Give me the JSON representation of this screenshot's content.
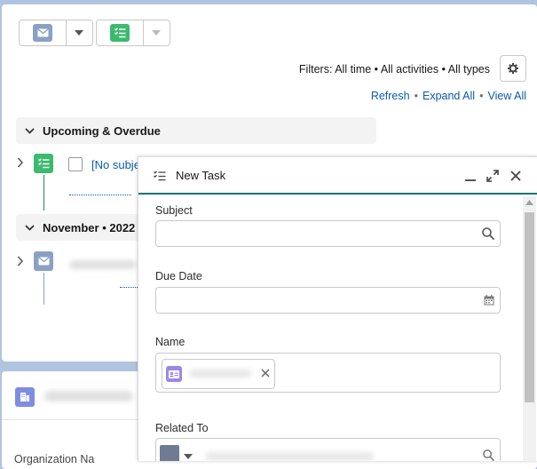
{
  "activity": {
    "filters_text": "Filters: All time • All activities • All types",
    "links": [
      "Refresh",
      "Expand All",
      "View All"
    ],
    "sections": [
      {
        "label": "Upcoming & Overdue"
      },
      {
        "label": "November • 2022"
      }
    ],
    "task_item_text": "[No subje"
  },
  "record_card": {
    "field_label_partial": "Organization Na"
  },
  "new_task": {
    "title": "New Task",
    "fields": {
      "subject": {
        "label": "Subject",
        "value": ""
      },
      "due_date": {
        "label": "Due Date",
        "value": ""
      },
      "name": {
        "label": "Name",
        "value": ""
      },
      "related_to": {
        "label": "Related To",
        "value": ""
      }
    }
  },
  "colors": {
    "email_icon_bg": "#8aa1c4",
    "task_icon_bg": "#3cba6e",
    "contact_icon_bg": "#9b87e8",
    "account_icon_bg": "#7f8de1",
    "link_blue": "#0b5cab",
    "header_accent": "#0b7477"
  }
}
